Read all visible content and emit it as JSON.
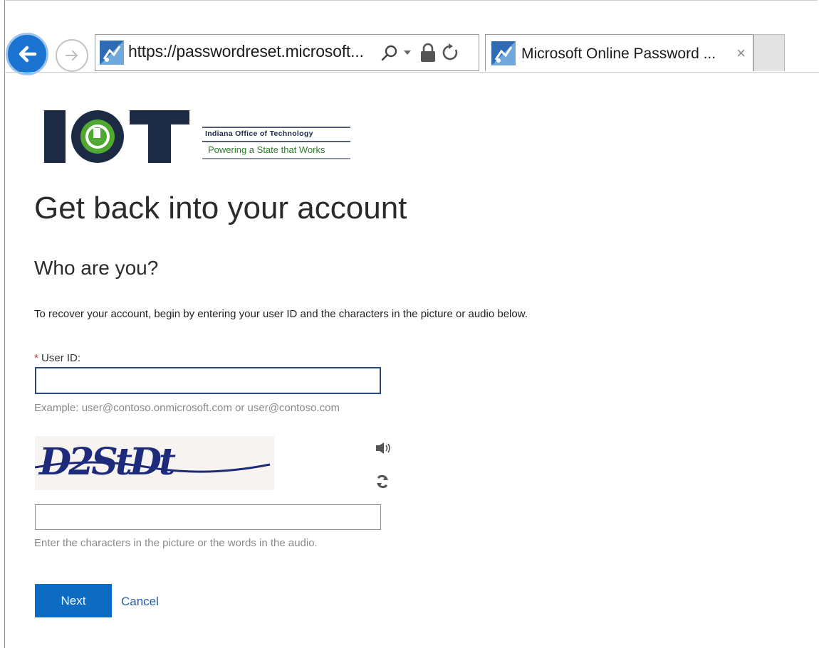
{
  "browser": {
    "url": "https://passwordreset.microsoft...",
    "tab_title": "Microsoft Online Password ...",
    "tab_close": "×"
  },
  "logo": {
    "letters": "IOT",
    "line1": "Indiana Office of Technology",
    "line2": "Powering a State that Works"
  },
  "page": {
    "title": "Get back into your account",
    "subtitle": "Who are you?",
    "intro": "To recover your account, begin by entering your user ID and the characters in the picture or audio below."
  },
  "form": {
    "required_mark": "*",
    "userid_label": "User ID:",
    "userid_value": "",
    "userid_hint": "Example: user@contoso.onmicrosoft.com or user@contoso.com",
    "captcha_text": "D2StDt",
    "captcha_value": "",
    "captcha_hint": "Enter the characters in the picture or the words in the audio.",
    "next_label": "Next",
    "cancel_label": "Cancel"
  },
  "colors": {
    "primary_button": "#0d6bc2",
    "link": "#1f5fa8",
    "back_button": "#1a73d1",
    "logo_navy": "#1c2a44",
    "logo_green": "#4fa82f"
  }
}
